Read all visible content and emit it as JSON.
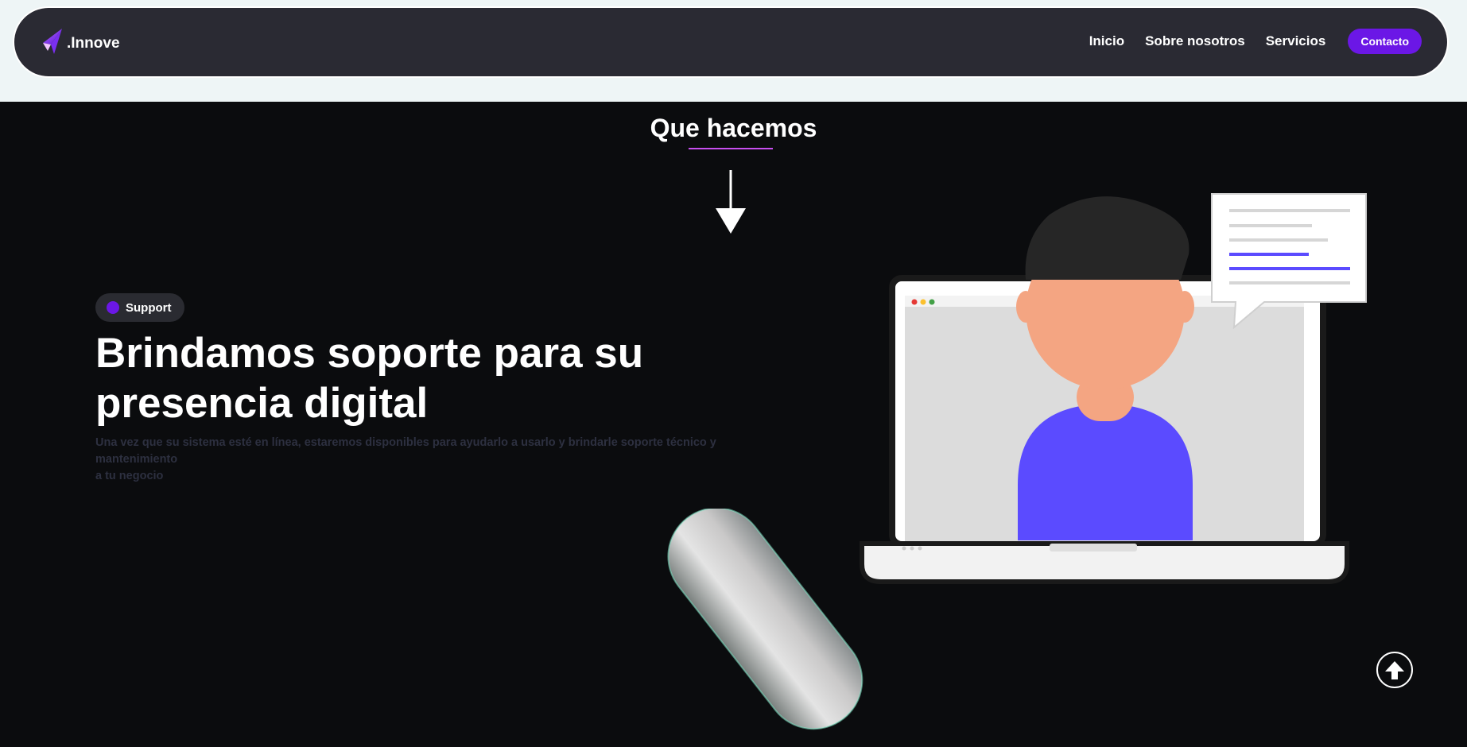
{
  "brand": {
    "name": ".Innove",
    "logo_icon": "paper-plane-logo-icon"
  },
  "nav": {
    "links": [
      "Inicio",
      "Sobre nosotros",
      "Servicios"
    ],
    "contact_label": "Contacto"
  },
  "section": {
    "title": "Que hacemos",
    "arrow_icon": "arrow-down-icon"
  },
  "hero": {
    "badge": "Support",
    "headline_line1": "Brindamos soporte para su",
    "headline_line2": "presencia digital",
    "description_line1": "Una vez que su sistema esté en línea, estaremos disponibles para ayudarlo a usarlo y brindarle soporte técnico y mantenimiento",
    "description_line2": "a tu negocio"
  },
  "scroll_top_icon": "arrow-up-circle-icon",
  "colors": {
    "accent": "#6b17e6",
    "nav_bg": "#2a2a33",
    "page_bg": "#0b0c0e",
    "underline": "#c84ff0",
    "figure_shirt": "#5b4bff",
    "figure_skin": "#f4a582"
  }
}
